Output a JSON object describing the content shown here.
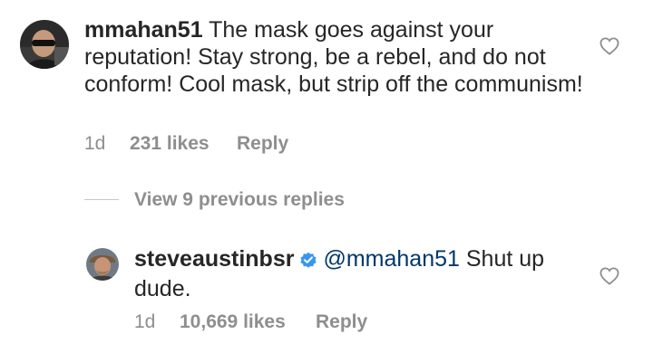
{
  "comment": {
    "username": "mmahan51",
    "text": "The mask goes against your reputation!  Stay strong, be a rebel, and do not conform!  Cool mask, but strip off the communism!",
    "time": "1d",
    "likes": "231 likes",
    "reply_label": "Reply",
    "icons": {
      "avatar": "user-avatar",
      "like": "heart-outline-icon"
    }
  },
  "view_replies": {
    "label": "View 9 previous replies"
  },
  "reply": {
    "username": "steveaustinbsr",
    "verified_icon": "verified-badge-icon",
    "mention": "@mmahan51",
    "text": "Shut up dude.",
    "time": "1d",
    "likes": "10,669 likes",
    "reply_label": "Reply",
    "icons": {
      "avatar": "user-avatar",
      "like": "heart-outline-icon"
    }
  },
  "colors": {
    "text": "#262626",
    "secondary": "#8e8e8e",
    "mention": "#00376b",
    "verified": "#3897f0"
  }
}
